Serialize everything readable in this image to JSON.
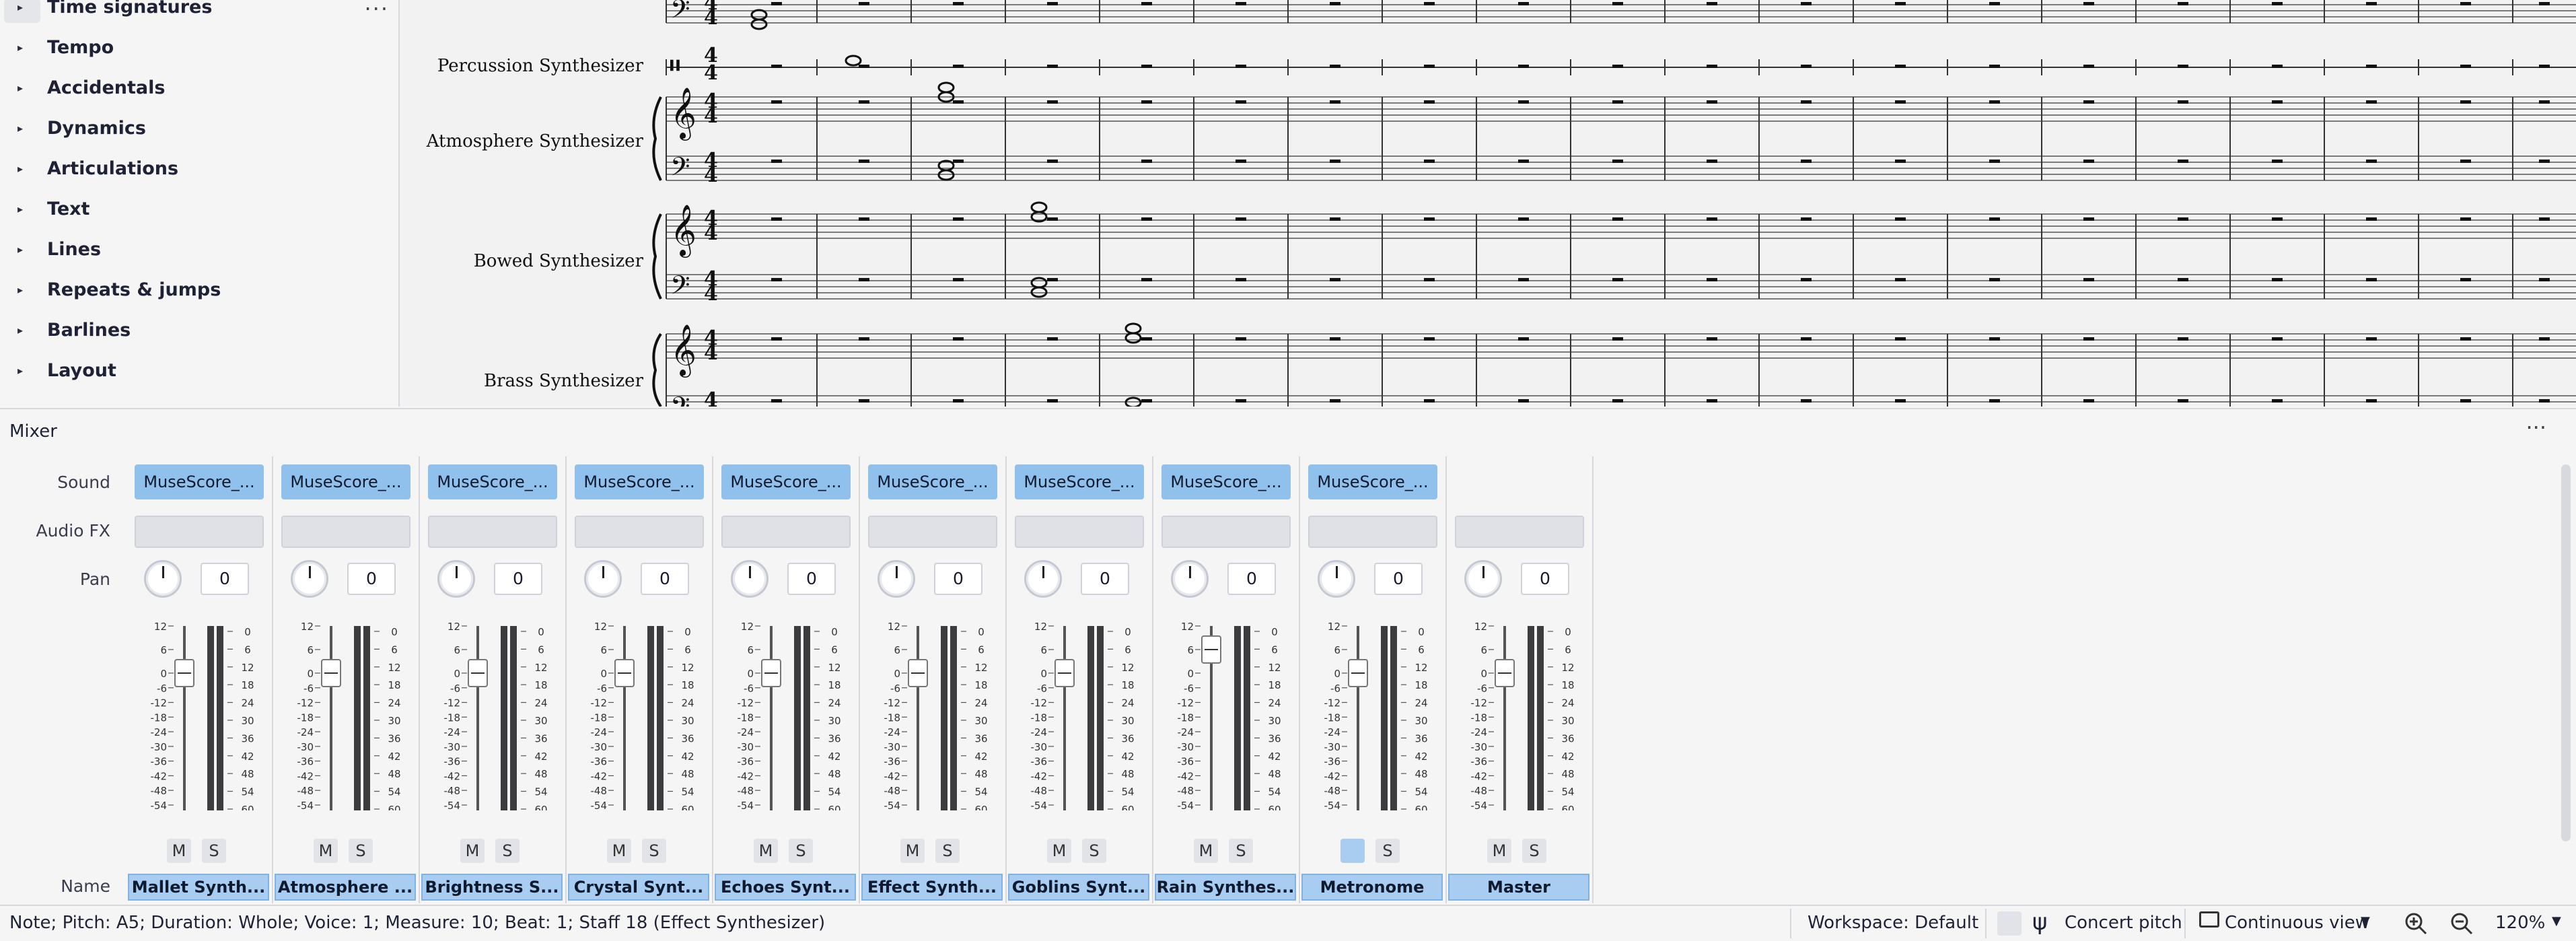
{
  "palette": {
    "items": [
      {
        "label": "Time signatures"
      },
      {
        "label": "Tempo"
      },
      {
        "label": "Accidentals"
      },
      {
        "label": "Dynamics"
      },
      {
        "label": "Articulations"
      },
      {
        "label": "Text"
      },
      {
        "label": "Lines"
      },
      {
        "label": "Repeats & jumps"
      },
      {
        "label": "Barlines"
      },
      {
        "label": "Layout"
      }
    ],
    "more": "···"
  },
  "score": {
    "instruments": [
      "Percussion Synthesizer",
      "Atmosphere Synthesizer",
      "Bowed Synthesizer",
      "Brass Synthesizer"
    ],
    "time_signature": {
      "top": "4",
      "bottom": "4"
    }
  },
  "mixer": {
    "title": "Mixer",
    "more": "···",
    "row_labels": {
      "sound": "Sound",
      "audio_fx": "Audio FX",
      "pan": "Pan",
      "name": "Name"
    },
    "scale_left": [
      "12",
      "6",
      "0",
      "-6",
      "-12",
      "-18",
      "-24",
      "-30",
      "-36",
      "-42",
      "-48",
      "-54",
      "-∞"
    ],
    "scale_right": [
      "0",
      "6",
      "12",
      "18",
      "24",
      "30",
      "36",
      "42",
      "48",
      "54",
      "60"
    ],
    "mute_label": "M",
    "solo_label": "S",
    "channels": [
      {
        "sound": "MuseScore_...",
        "pan": "0",
        "name": "Mallet Synth...",
        "volume_db": 0,
        "muted": false
      },
      {
        "sound": "MuseScore_...",
        "pan": "0",
        "name": "Atmosphere ...",
        "volume_db": 0,
        "muted": false
      },
      {
        "sound": "MuseScore_...",
        "pan": "0",
        "name": "Brightness S...",
        "volume_db": 0,
        "muted": false
      },
      {
        "sound": "MuseScore_...",
        "pan": "0",
        "name": "Crystal Synt...",
        "volume_db": 0,
        "muted": false
      },
      {
        "sound": "MuseScore_...",
        "pan": "0",
        "name": "Echoes Synt...",
        "volume_db": 0,
        "muted": false
      },
      {
        "sound": "MuseScore_...",
        "pan": "0",
        "name": "Effect Synth...",
        "volume_db": 0,
        "muted": false
      },
      {
        "sound": "MuseScore_...",
        "pan": "0",
        "name": "Goblins Synt...",
        "volume_db": 0,
        "muted": false
      },
      {
        "sound": "MuseScore_...",
        "pan": "0",
        "name": "Rain Synthes...",
        "volume_db": 6,
        "muted": false
      },
      {
        "sound": "MuseScore_...",
        "pan": "0",
        "name": "Metronome",
        "volume_db": 0,
        "muted": true
      },
      {
        "sound": "",
        "pan": "0",
        "name": "Master",
        "volume_db": 0,
        "muted": false
      }
    ]
  },
  "status": {
    "selection": "Note; Pitch: A5; Duration: Whole; Voice: 1; Measure: 10; Beat: 1; Staff 18 (Effect Synthesizer)",
    "workspace": "Workspace: Default",
    "concert_pitch": "Concert pitch",
    "view_mode": "Continuous view",
    "zoom": "120%"
  }
}
